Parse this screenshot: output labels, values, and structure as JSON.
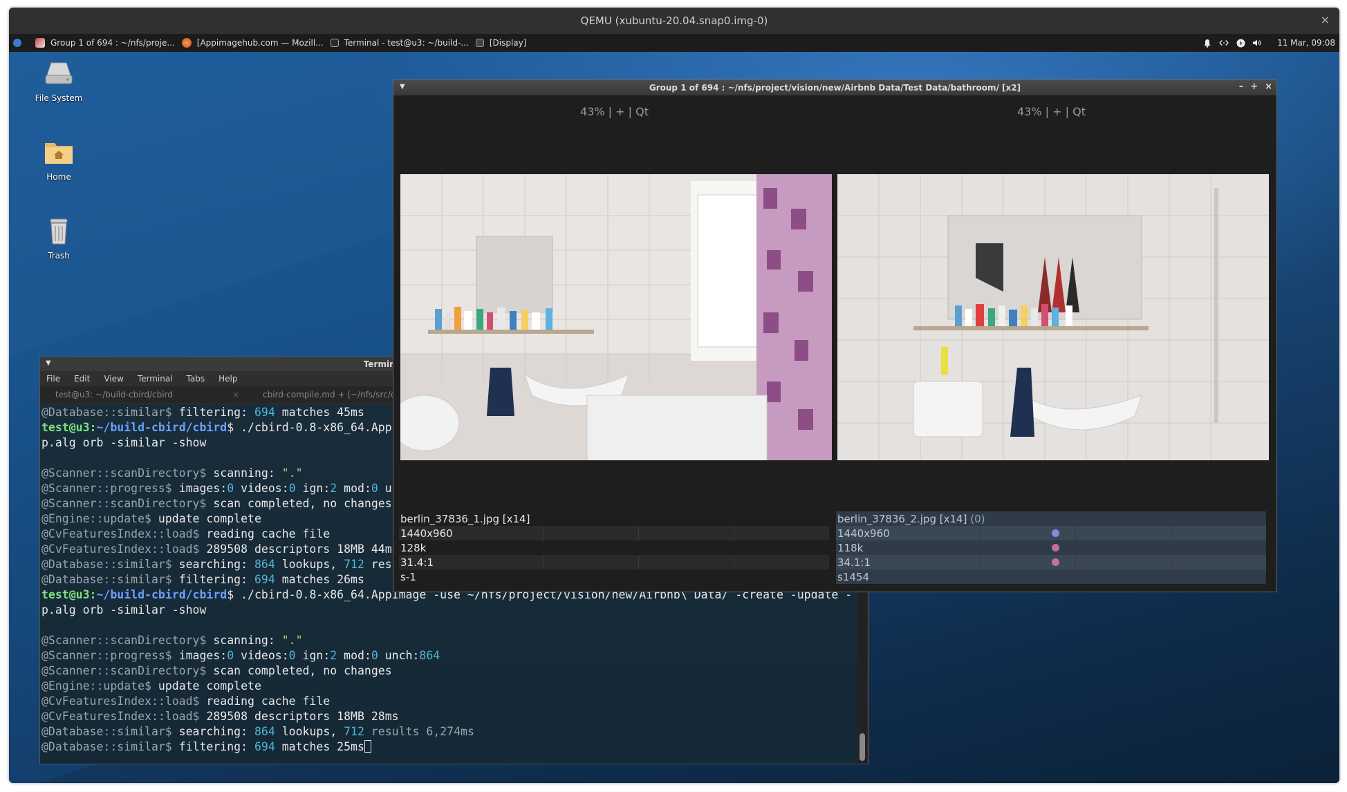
{
  "qemu": {
    "title": "QEMU (xubuntu-20.04.snap0.img-0)",
    "close_glyph": "×"
  },
  "panel": {
    "tasks": [
      {
        "label": "Group 1 of 694 : ~/nfs/proje...",
        "icon": "cbird-app-icon"
      },
      {
        "label": "[Appimagehub.com — Mozill...",
        "icon": "firefox-icon"
      },
      {
        "label": "Terminal - test@u3: ~/build-...",
        "icon": "terminal-icon"
      },
      {
        "label": "[Display]",
        "icon": "display-icon"
      }
    ],
    "clock": "11 Mar, 09:08"
  },
  "desktop": {
    "icons": [
      {
        "label": "File System"
      },
      {
        "label": "Home"
      },
      {
        "label": "Trash"
      }
    ]
  },
  "terminal": {
    "title": "Terminal - test@u3: ~/build-cbird/cbird",
    "menu": [
      "File",
      "Edit",
      "View",
      "Terminal",
      "Tabs",
      "Help"
    ],
    "tabs": [
      {
        "label": "test@u3: ~/build-cbird/cbird",
        "close": "×"
      },
      {
        "label": "cbird-compile.md + (~/nfs/src/cbird) - VIM"
      }
    ],
    "lines": [
      [
        {
          "t": "@Database::similar$",
          "c": "dim"
        },
        {
          "t": " filtering: "
        },
        {
          "t": "694",
          "c": "num"
        },
        {
          "t": " matches 45ms"
        }
      ],
      [
        {
          "t": "test@u3",
          "c": "prompt-user"
        },
        {
          "t": ":",
          "c": "prompt-user"
        },
        {
          "t": "~/build-cbird/cbird",
          "c": "prompt-path"
        },
        {
          "t": "$ ./cbird-0.8-x86_64.AppImage -use ~/nfs/project/vision/new/Airbnb\\ Data/ -create -update -"
        }
      ],
      [
        {
          "t": "p.alg orb -similar -show"
        }
      ],
      [
        {
          "t": ""
        }
      ],
      [
        {
          "t": "@Scanner::scanDirectory$",
          "c": "dim"
        },
        {
          "t": " scanning: "
        },
        {
          "t": "\".\"",
          "c": "str"
        }
      ],
      [
        {
          "t": "@Scanner::progress$",
          "c": "dim"
        },
        {
          "t": " images:"
        },
        {
          "t": "0",
          "c": "num"
        },
        {
          "t": " videos:"
        },
        {
          "t": "0",
          "c": "num"
        },
        {
          "t": " ign:"
        },
        {
          "t": "2",
          "c": "num"
        },
        {
          "t": " mod:"
        },
        {
          "t": "0",
          "c": "num"
        },
        {
          "t": " unch:"
        },
        {
          "t": "864",
          "c": "num"
        }
      ],
      [
        {
          "t": "@Scanner::scanDirectory$",
          "c": "dim"
        },
        {
          "t": " scan completed, no changes"
        }
      ],
      [
        {
          "t": "@Engine::update$",
          "c": "dim"
        },
        {
          "t": " update complete"
        }
      ],
      [
        {
          "t": "@CvFeaturesIndex::load$",
          "c": "dim"
        },
        {
          "t": " reading cache file"
        }
      ],
      [
        {
          "t": "@CvFeaturesIndex::load$",
          "c": "dim"
        },
        {
          "t": " 289508 descriptors 18MB 44ms"
        }
      ],
      [
        {
          "t": "@Database::similar$",
          "c": "dim"
        },
        {
          "t": " searching: "
        },
        {
          "t": "864",
          "c": "num"
        },
        {
          "t": " lookups, "
        },
        {
          "t": "712",
          "c": "num"
        },
        {
          "t": " results 6,361ms"
        }
      ],
      [
        {
          "t": "@Database::similar$",
          "c": "dim"
        },
        {
          "t": " filtering: "
        },
        {
          "t": "694",
          "c": "num"
        },
        {
          "t": " matches 26ms"
        }
      ],
      [
        {
          "t": "test@u3",
          "c": "prompt-user"
        },
        {
          "t": ":",
          "c": "prompt-user"
        },
        {
          "t": "~/build-cbird/cbird",
          "c": "prompt-path"
        },
        {
          "t": "$ ./cbird-0.8-x86_64.AppImage -use ~/nfs/project/vision/new/Airbnb\\ Data/ -create -update -"
        }
      ],
      [
        {
          "t": "p.alg orb -similar -show"
        }
      ],
      [
        {
          "t": ""
        }
      ],
      [
        {
          "t": "@Scanner::scanDirectory$",
          "c": "dim"
        },
        {
          "t": " scanning: "
        },
        {
          "t": "\".\"",
          "c": "str"
        }
      ],
      [
        {
          "t": "@Scanner::progress$",
          "c": "dim"
        },
        {
          "t": " images:"
        },
        {
          "t": "0",
          "c": "num"
        },
        {
          "t": " videos:"
        },
        {
          "t": "0",
          "c": "num"
        },
        {
          "t": " ign:"
        },
        {
          "t": "2",
          "c": "num"
        },
        {
          "t": " mod:"
        },
        {
          "t": "0",
          "c": "num"
        },
        {
          "t": " unch:"
        },
        {
          "t": "864",
          "c": "num"
        }
      ],
      [
        {
          "t": "@Scanner::scanDirectory$",
          "c": "dim"
        },
        {
          "t": " scan completed, no changes"
        }
      ],
      [
        {
          "t": "@Engine::update$",
          "c": "dim"
        },
        {
          "t": " update complete"
        }
      ],
      [
        {
          "t": "@CvFeaturesIndex::load$",
          "c": "dim"
        },
        {
          "t": " reading cache file"
        }
      ],
      [
        {
          "t": "@CvFeaturesIndex::load$",
          "c": "dim"
        },
        {
          "t": " 289508 descriptors 18MB 28ms"
        }
      ],
      [
        {
          "t": "@Database::similar$",
          "c": "dim"
        },
        {
          "t": " searching: "
        },
        {
          "t": "864",
          "c": "num"
        },
        {
          "t": " lookups, "
        },
        {
          "t": "712",
          "c": "num"
        },
        {
          "t": " results 6,274ms",
          "c": "dim"
        }
      ],
      [
        {
          "t": "@Database::similar$",
          "c": "dim"
        },
        {
          "t": " filtering: "
        },
        {
          "t": "694",
          "c": "num"
        },
        {
          "t": " matches 25ms"
        }
      ]
    ]
  },
  "cbird": {
    "title": "Group 1 of 694 : ~/nfs/project/vision/new/Airbnb Data/Test Data/bathroom/ [x2]",
    "controls": {
      "minimize": "–",
      "maximize": "+",
      "close": "×"
    },
    "left": {
      "zoom": "43% | + | Qt",
      "filename": "berlin_37836_1.jpg [x14]",
      "resolution": "1440x960",
      "size": "128k",
      "compression": "31.4:1",
      "score": "s-1"
    },
    "right": {
      "zoom": "43% | + | Qt",
      "filename": "berlin_37836_2.jpg [x14]",
      "filename_suffix": "(0)",
      "resolution": "1440x960",
      "size": "118k",
      "compression": "34.1:1",
      "score": "s1454"
    },
    "colors": {
      "dot_blue": "#7d8fe0",
      "dot_pink": "#c86e93"
    }
  }
}
